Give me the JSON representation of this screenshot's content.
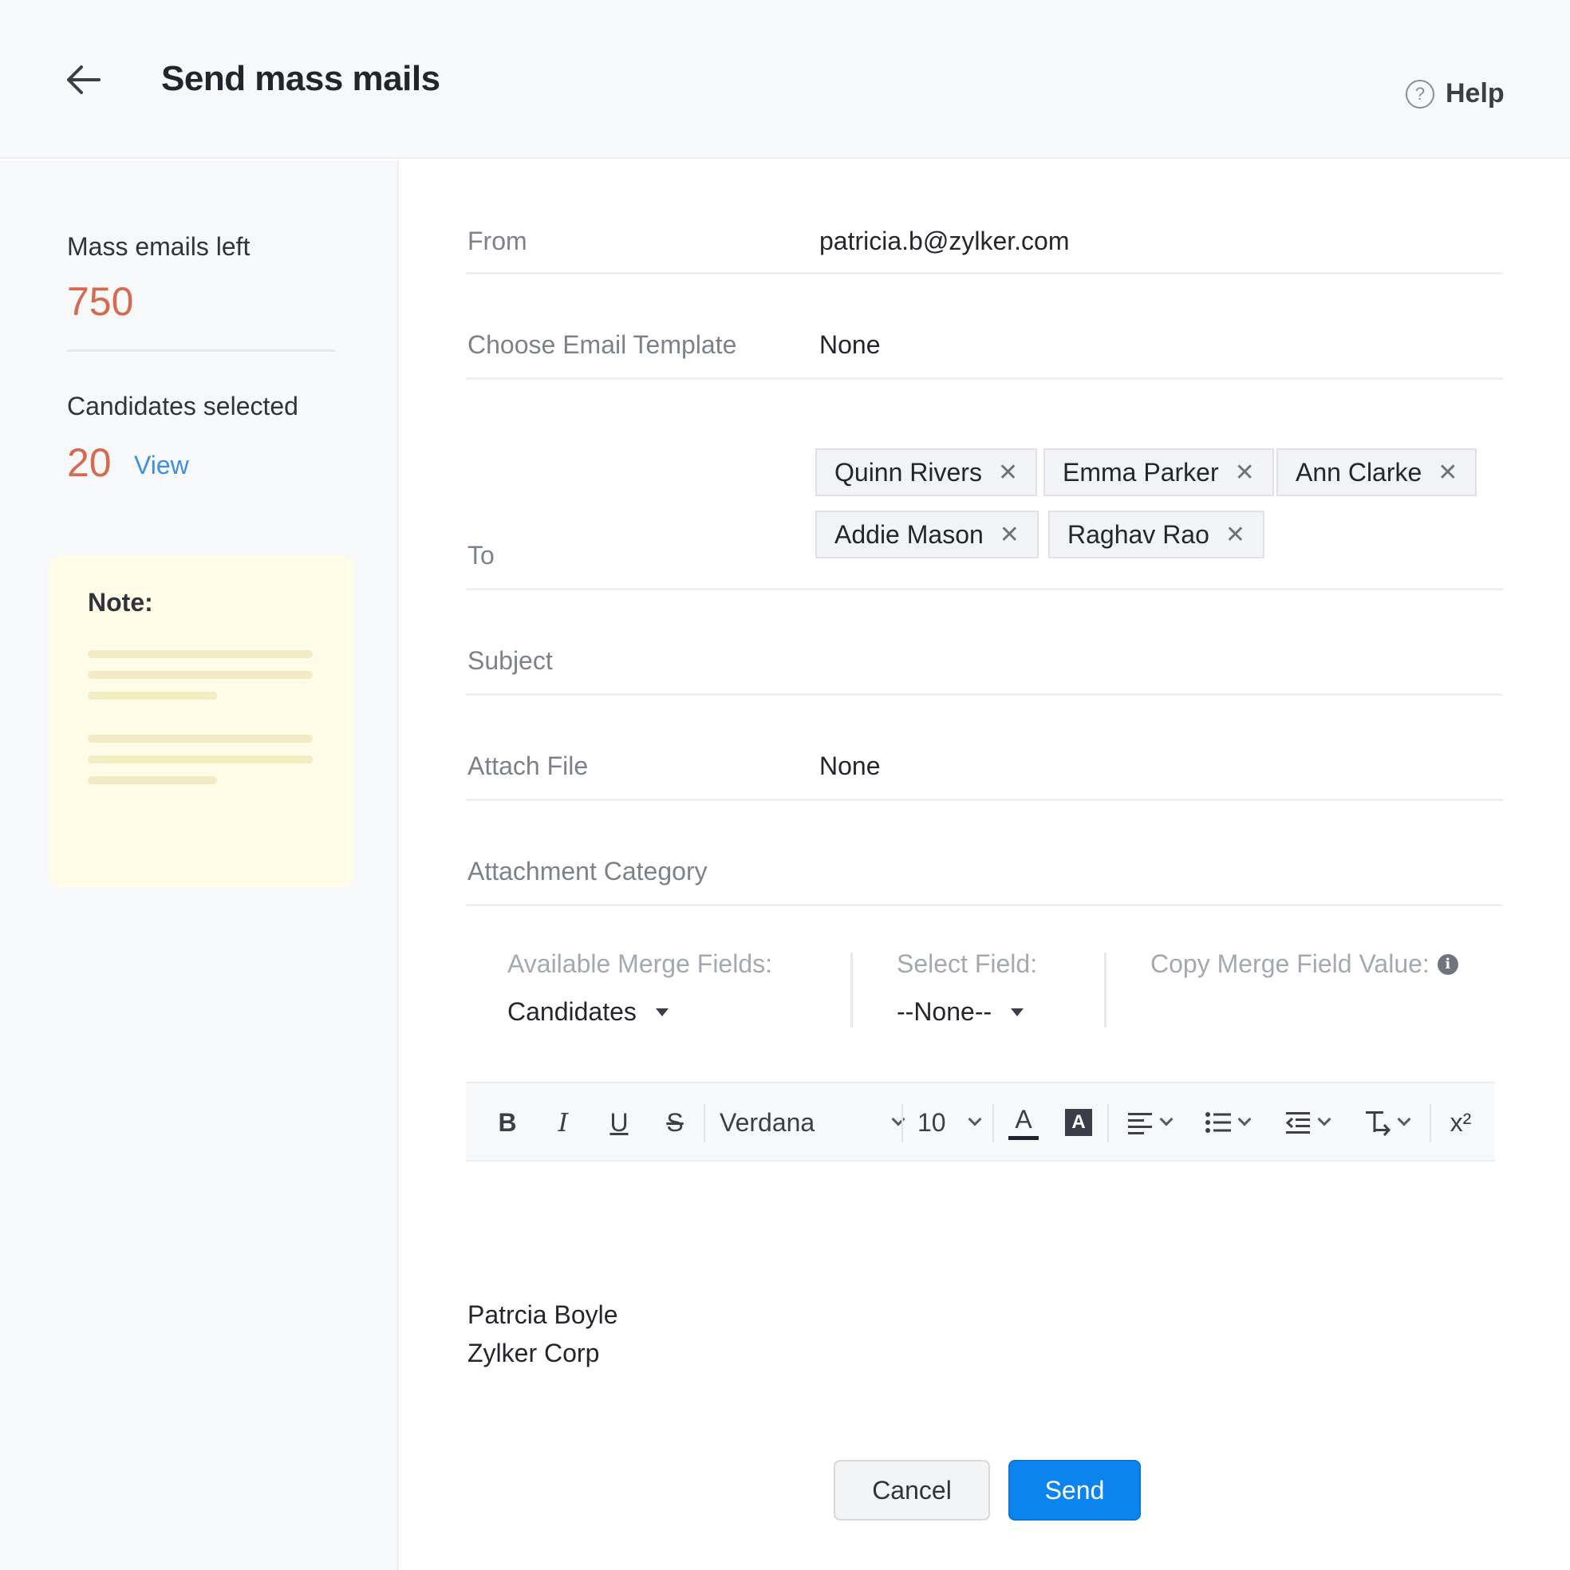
{
  "header": {
    "title": "Send mass mails",
    "help_label": "Help",
    "help_icon": "?"
  },
  "sidebar": {
    "mass_emails_label": "Mass emails left",
    "mass_emails_value": "750",
    "candidates_label": "Candidates selected",
    "candidates_value": "20",
    "view_label": "View",
    "note_title": "Note:"
  },
  "form": {
    "from_label": "From",
    "from_value": "patricia.b@zylker.com",
    "template_label": "Choose Email Template",
    "template_value": "None",
    "to_label": "To",
    "recipients": [
      "Quinn Rivers",
      "Emma Parker",
      "Ann Clarke",
      "Addie Mason",
      "Raghav Rao"
    ],
    "subject_label": "Subject",
    "attach_label": "Attach File",
    "attach_value": "None",
    "attachment_category_label": "Attachment Category"
  },
  "merge": {
    "available_label": "Available Merge Fields:",
    "available_value": "Candidates",
    "select_label": "Select Field:",
    "select_value": "--None--",
    "copy_label": "Copy Merge Field Value:",
    "info_glyph": "i"
  },
  "toolbar": {
    "bold": "B",
    "italic": "I",
    "underline": "U",
    "strike": "S",
    "font": "Verdana",
    "size": "10",
    "text_color": "A",
    "bg_color": "A",
    "superscript": "x²"
  },
  "signature": {
    "name": "Patrcia Boyle",
    "company": "Zylker Corp"
  },
  "buttons": {
    "cancel": "Cancel",
    "send": "Send"
  },
  "colors": {
    "accent": "#0b84f0",
    "stat": "#d7694e",
    "link": "#3d8fe0",
    "note_bg": "#fffbe6"
  }
}
